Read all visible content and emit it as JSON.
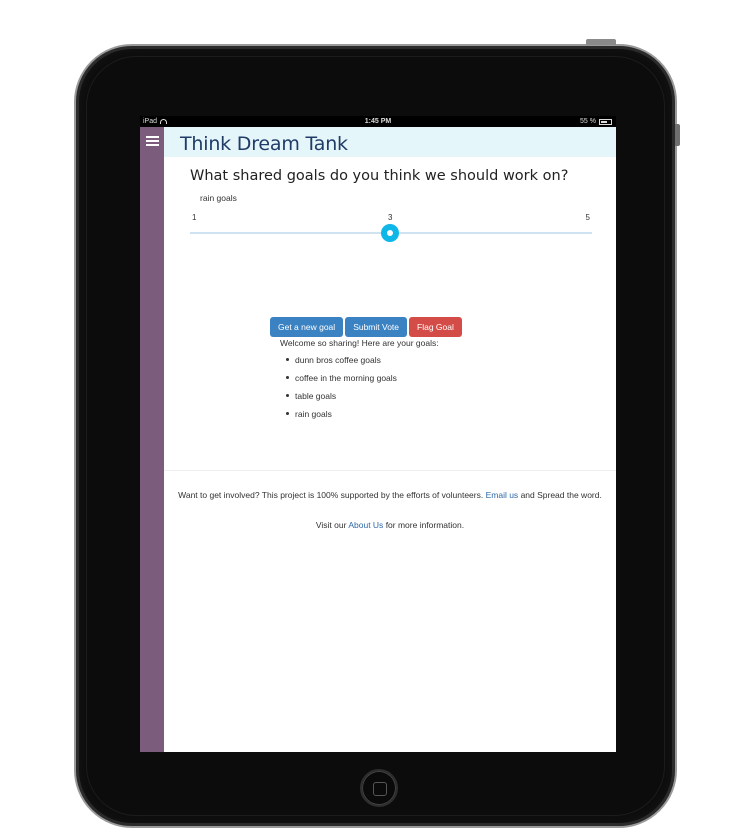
{
  "status_bar": {
    "device": "iPad",
    "time": "1:45 PM",
    "battery": "55 %"
  },
  "header": {
    "title": "Think Dream Tank"
  },
  "question": "What shared goals do you think we should work on?",
  "current_goal": "rain goals",
  "slider": {
    "min_label": "1",
    "mid_label": "3",
    "max_label": "5",
    "value": 3
  },
  "buttons": {
    "new_goal": "Get a new goal",
    "submit_vote": "Submit Vote",
    "flag_goal": "Flag Goal"
  },
  "welcome": "Welcome so sharing! Here are your goals:",
  "goals": [
    "dunn bros coffee goals",
    "coffee in the morning goals",
    "table goals",
    "rain goals"
  ],
  "footer": {
    "line1_prefix": "Want to get involved? This project is 100% supported by the efforts of volunteers.",
    "email_link": "Email us",
    "line1_suffix": "and Spread the word.",
    "line2_prefix": "Visit our",
    "about_link": "About Us",
    "line2_suffix": "for more information."
  },
  "colors": {
    "sidebar": "#7b5c7c",
    "header_bg": "#e5f6fb",
    "title": "#1f3b66",
    "primary": "#3b82c3",
    "danger": "#d44c48",
    "slider_thumb": "#0fb6e8"
  }
}
